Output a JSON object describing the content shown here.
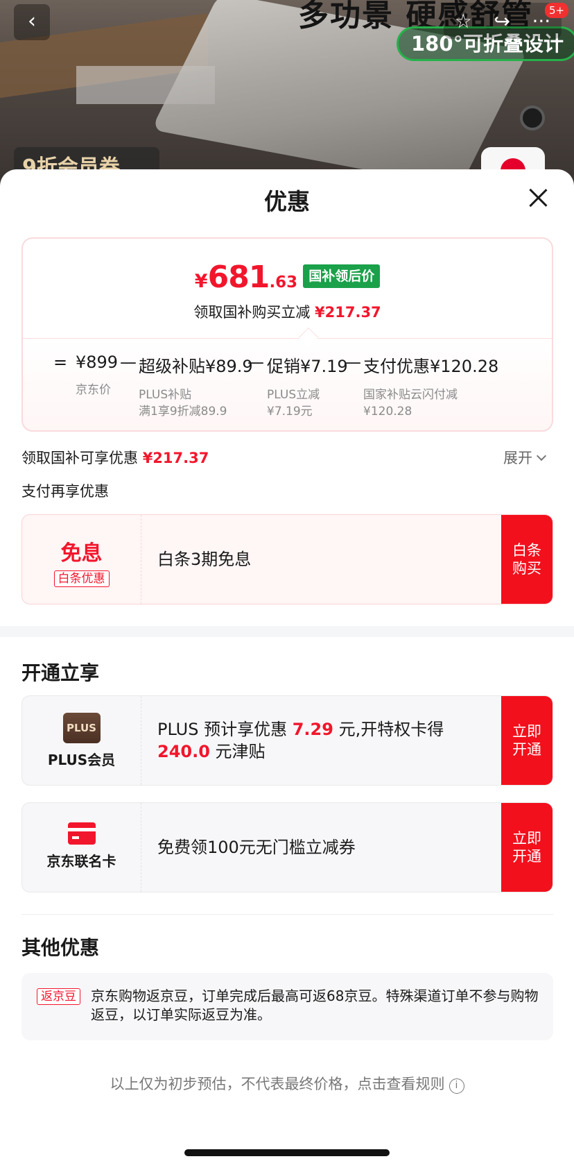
{
  "hero": {
    "scene_text": "多功景 硬感舒管",
    "fold_badge": "180°可折叠设计",
    "member_badge": "9折会员券",
    "cart_count": "5+",
    "back_glyph": "‹",
    "star_glyph": "☆",
    "share_glyph": "↪",
    "more_glyph": "···"
  },
  "sheet": {
    "title": "优惠"
  },
  "price_card": {
    "currency": "¥",
    "price_int": "681",
    "price_dec": ".63",
    "price_tag": "国补领后价",
    "subsidy_text": "领取国补购买立减 ",
    "subsidy_amount": "¥217.37",
    "breakdown": {
      "eq": "=",
      "jd_price": "¥899",
      "jd_price_label": "京东价",
      "minus": "—",
      "super_subsidy": "超级补贴¥89.9",
      "super_subsidy_sub1": "PLUS补贴",
      "super_subsidy_sub2": "满1享9折减89.9",
      "promo": "促销¥7.19",
      "promo_sub1": "PLUS立减",
      "promo_sub2": "¥7.19元",
      "pay_discount": "支付优惠¥120.28",
      "pay_discount_sub1": "国家补贴云闪付减",
      "pay_discount_sub2": "¥120.28"
    }
  },
  "summary": {
    "text": "领取国补可享优惠 ",
    "amount": "¥217.37",
    "expand": "展开"
  },
  "pay_section": {
    "title": "支付再享优惠",
    "baitiao_card": {
      "left_title": "免息",
      "left_tag": "白条优惠",
      "text": "白条3期免息",
      "button": "白条购买"
    }
  },
  "open_section": {
    "title": "开通立享",
    "plus_card": {
      "logo": "PLUS",
      "label": "PLUS会员",
      "text_1": "PLUS 预计享优惠 ",
      "amount_1": "7.29",
      "text_2": " 元,开特权卡得",
      "amount_2": "240.0",
      "text_3": " 元津贴",
      "button": "立即开通"
    },
    "card_card": {
      "label": "京东联名卡",
      "text": "免费领100元无门槛立减券",
      "button": "立即开通"
    }
  },
  "other_section": {
    "title": "其他优惠",
    "tag": "返京豆",
    "text": "京东购物返京豆，订单完成后最高可返68京豆。特殊渠道订单不参与购物返豆，以订单实际返豆为准。"
  },
  "footer": {
    "disclaimer": "以上仅为初步预估，不代表最终价格，点击查看规则",
    "info_glyph": "i"
  },
  "colors": {
    "accent_red": "#f2162c",
    "green_tag": "#1aa14a",
    "button_red": "#f2101c"
  }
}
